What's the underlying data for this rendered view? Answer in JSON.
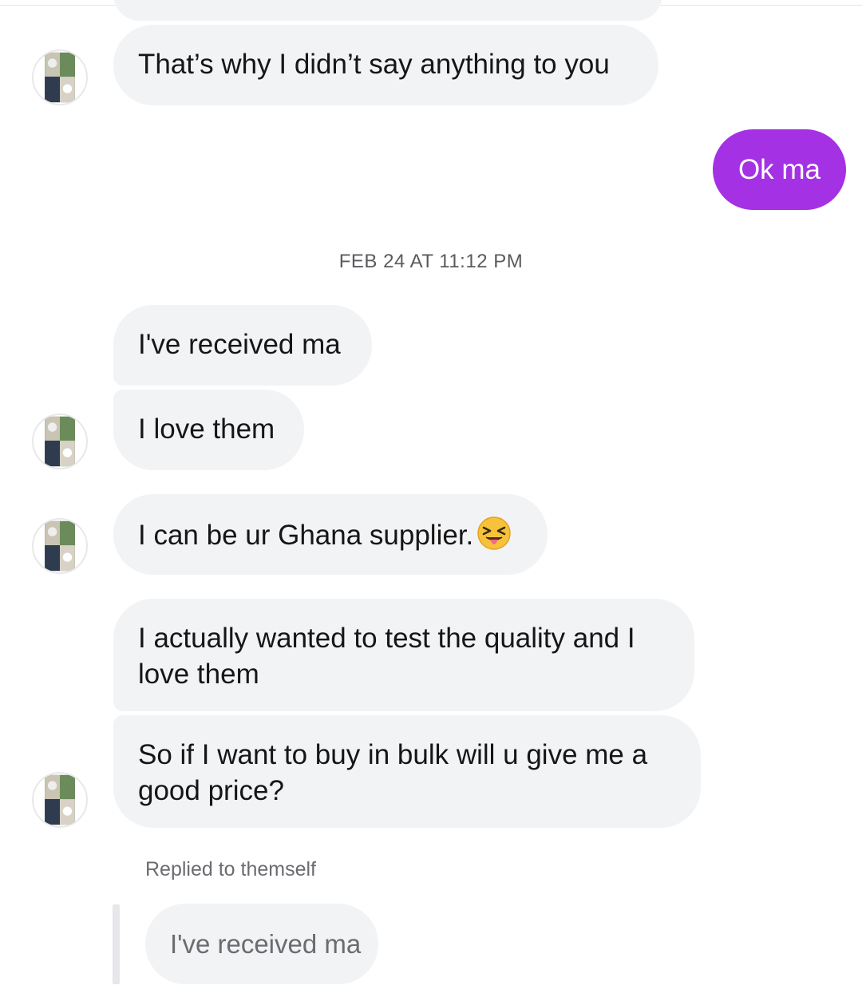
{
  "top_message_fragment": "",
  "messages_received": [
    {
      "id": "m1",
      "text": "That’s why I didn’t say anything to you"
    },
    {
      "id": "m2",
      "text": "I've received ma"
    },
    {
      "id": "m3",
      "text": "I love them"
    },
    {
      "id": "m4",
      "text": "I can be ur Ghana supplier."
    },
    {
      "id": "m5",
      "text": "I actually wanted to test the quality and I love them"
    },
    {
      "id": "m6",
      "text": "So if I want to buy in bulk will u give me a good price?"
    }
  ],
  "message_sent": {
    "text": "Ok ma",
    "color": "#a431e3"
  },
  "timestamp": "FEB 24 AT 11:12 PM",
  "reply": {
    "label": "Replied to themself",
    "quoted_text": "I've received ma"
  },
  "emoji": {
    "name": "squinting-face-with-tongue-icon"
  },
  "colors": {
    "received_bubble": "#f2f3f5",
    "sent_bubble": "#a431e3",
    "meta_text": "#6b6b70"
  }
}
